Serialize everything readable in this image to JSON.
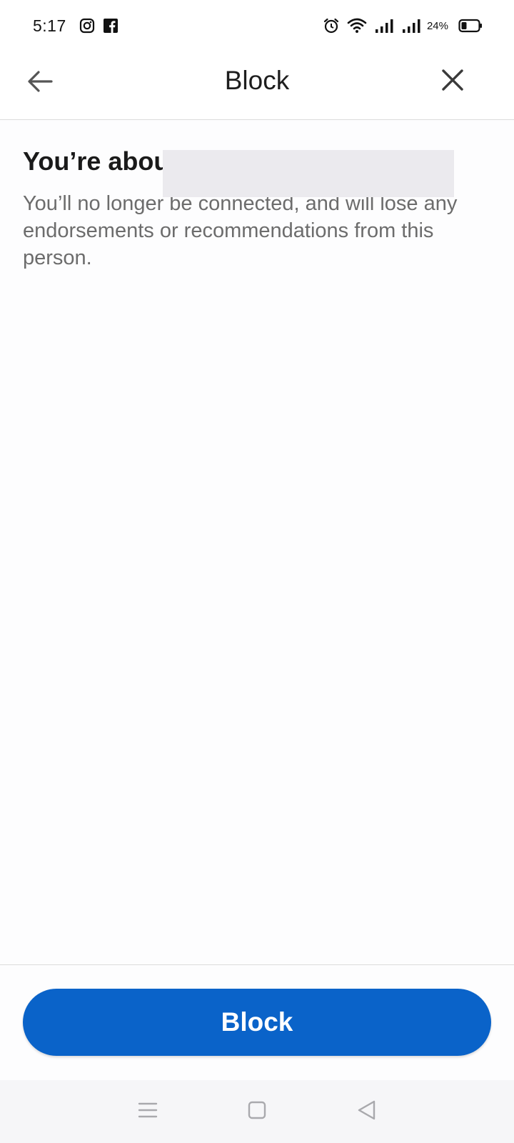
{
  "status_bar": {
    "time": "5:17",
    "left_icons": [
      "instagram-icon",
      "facebook-icon"
    ],
    "right_icons": [
      "alarm-icon",
      "wifi-icon",
      "signal-icon",
      "signal-icon"
    ],
    "battery_percent": "24%"
  },
  "app_bar": {
    "title": "Block",
    "back_icon": "arrow-left-icon",
    "close_icon": "close-icon"
  },
  "content": {
    "heading_visible": "You’re abou",
    "heading_redacted": true,
    "description": "You’ll no longer be connected, and will lose any endorsements or recommendations from this person."
  },
  "footer": {
    "primary_button_label": "Block"
  },
  "navigation_bar": {
    "buttons": [
      "menu-icon",
      "home-icon",
      "back-triangle-icon"
    ]
  },
  "colors": {
    "accent": "#0a63c9",
    "text_primary": "#1a1a1a",
    "text_secondary": "#6c6c6c",
    "divider": "#dcdcdc",
    "redaction": "#ebeaee"
  }
}
